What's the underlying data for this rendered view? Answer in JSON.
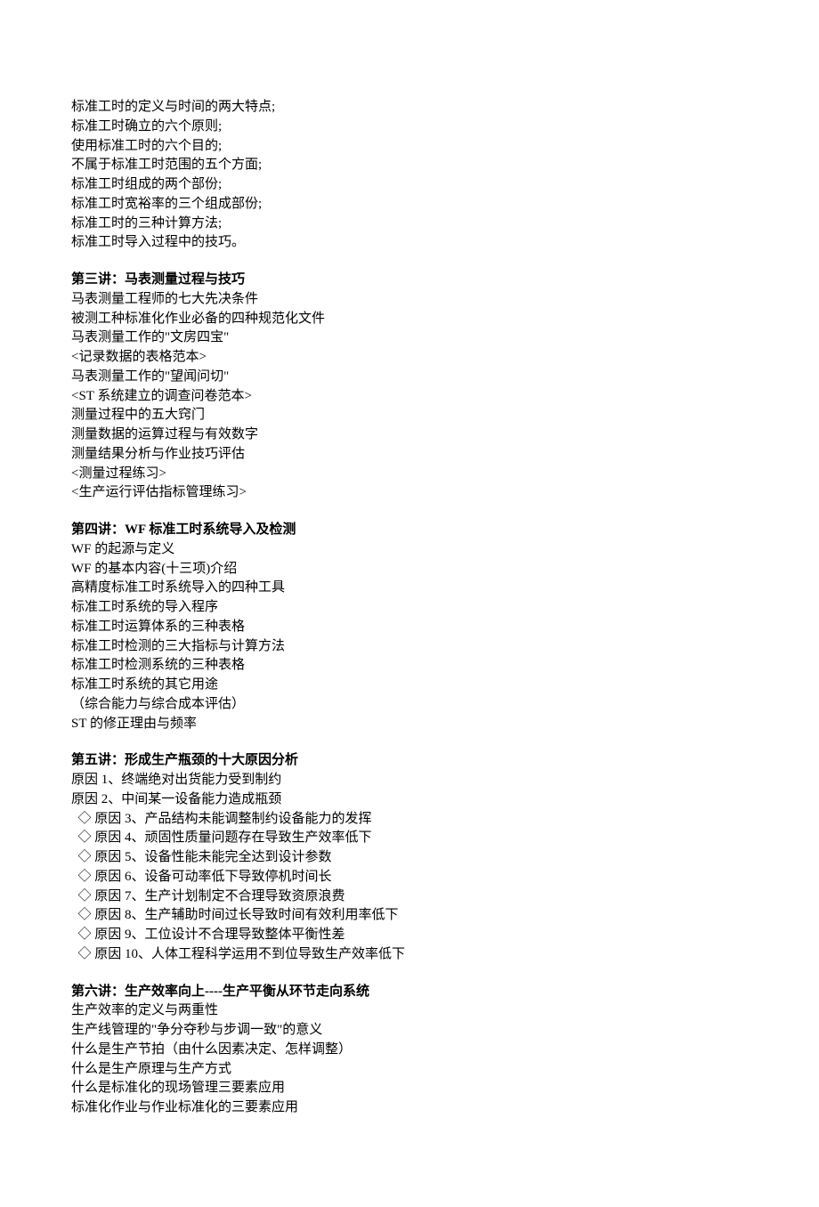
{
  "section1": {
    "lines": [
      "标准工时的定义与时间的两大特点;",
      "标准工时确立的六个原则;",
      "使用标准工时的六个目的;",
      "不属于标准工时范围的五个方面;",
      "标准工时组成的两个部份;",
      "标准工时宽裕率的三个组成部份;",
      "标准工时的三种计算方法;",
      "标准工时导入过程中的技巧。"
    ]
  },
  "section2": {
    "heading": "第三讲：马表测量过程与技巧",
    "lines": [
      "马表测量工程师的七大先决条件",
      "被测工种标准化作业必备的四种规范化文件",
      "马表测量工作的\"文房四宝\"",
      "<记录数据的表格范本>",
      "马表测量工作的\"望闻问切\"",
      "<ST 系统建立的调查问卷范本>",
      "测量过程中的五大窍门",
      "测量数据的运算过程与有效数字",
      "测量结果分析与作业技巧评估",
      "<测量过程练习>",
      "<生产运行评估指标管理练习>"
    ]
  },
  "section3": {
    "heading": "第四讲：WF 标准工时系统导入及检测",
    "lines": [
      "WF 的起源与定义",
      "WF 的基本内容(十三项)介绍",
      "高精度标准工时系统导入的四种工具",
      "标准工时系统的导入程序",
      "标准工时运算体系的三种表格",
      "标准工时检测的三大指标与计算方法",
      "标准工时检测系统的三种表格",
      "标准工时系统的其它用途",
      "（综合能力与综合成本评估）",
      "ST 的修正理由与频率"
    ]
  },
  "section4": {
    "heading": "第五讲：形成生产瓶颈的十大原因分析",
    "lines": [
      "原因 1、终端绝对出货能力受到制约",
      "原因 2、中间某一设备能力造成瓶颈",
      "  ◇ 原因 3、产品结构未能调整制约设备能力的发挥",
      "  ◇ 原因 4、顽固性质量问题存在导致生产效率低下",
      "  ◇ 原因 5、设备性能未能完全达到设计参数",
      "  ◇ 原因 6、设备可动率低下导致停机时间长",
      "  ◇ 原因 7、生产计划制定不合理导致资原浪费",
      "  ◇ 原因 8、生产辅助时间过长导致时间有效利用率低下",
      "  ◇ 原因 9、工位设计不合理导致整体平衡性差",
      "  ◇ 原因 10、人体工程科学运用不到位导致生产效率低下"
    ]
  },
  "section5": {
    "heading": "第六讲：生产效率向上----生产平衡从环节走向系统",
    "lines": [
      "生产效率的定义与两重性",
      "生产线管理的\"争分夺秒与步调一致\"的意义",
      "什么是生产节拍（由什么因素决定、怎样调整）",
      "什么是生产原理与生产方式",
      "什么是标准化的现场管理三要素应用",
      "标准化作业与作业标准化的三要素应用"
    ]
  }
}
